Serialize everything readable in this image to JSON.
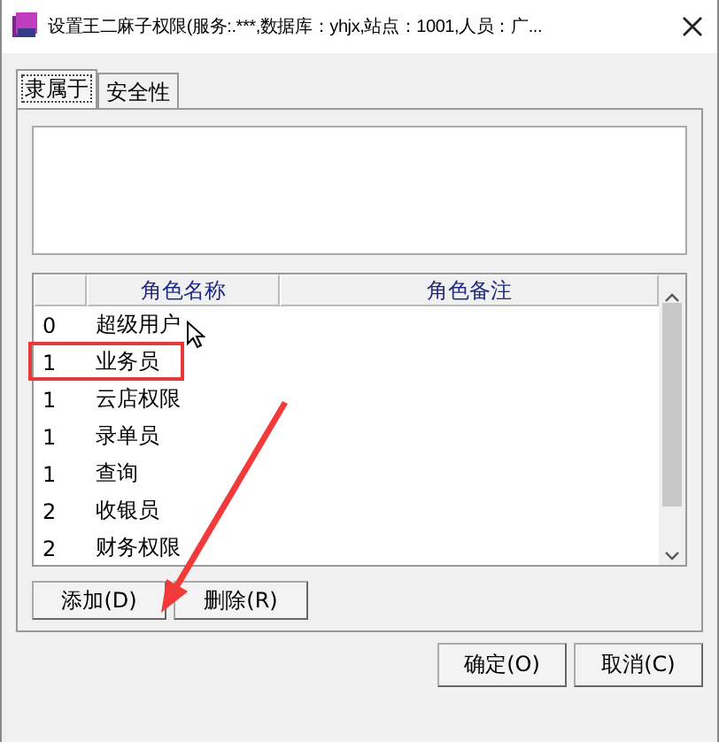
{
  "window": {
    "title": "设置王二麻子权限(服务:.***,数据库：yhjx,站点：1001,人员：广..."
  },
  "tabs": [
    {
      "label": "隶属于",
      "selected": true
    },
    {
      "label": "安全性",
      "selected": false
    }
  ],
  "table": {
    "columns": [
      "角色名称",
      "角色备注"
    ],
    "rows": [
      {
        "column_1": "0",
        "name": "超级用户",
        "highlighted": false
      },
      {
        "column_1": "1",
        "name": "业务员",
        "highlighted": true
      },
      {
        "column_1": "1",
        "name": "云店权限",
        "highlighted": false
      },
      {
        "column_1": "1",
        "name": "录单员",
        "highlighted": false
      },
      {
        "column_1": "1",
        "name": "查询",
        "highlighted": false
      },
      {
        "column_1": "2",
        "name": "收银员",
        "highlighted": false
      },
      {
        "column_1": "2",
        "name": "财务权限",
        "highlighted": false
      }
    ]
  },
  "list_buttons": [
    "添加(D)",
    "删除(R)"
  ],
  "dialog_buttons": [
    "确定(O)",
    "取消(C)"
  ]
}
